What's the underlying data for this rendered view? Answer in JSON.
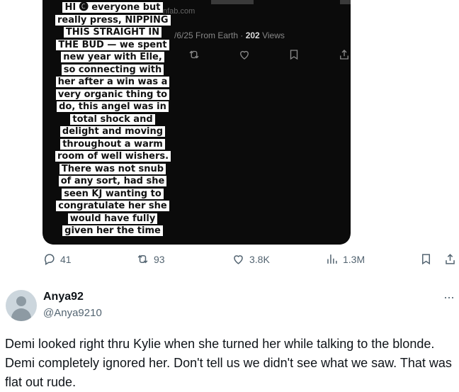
{
  "media": {
    "caption": "HI 🅒 everyone but really press, NIPPING THIS STRAIGHT IN THE BUD — we spent new year with Elle, so connecting with her after a win was a very organic thing to do, this angel was in total shock and delight and moving throughout a warm room of well wishers. There was not snub of any sort, had she seen KJ wanting to congratulate her she would have fully given her the time and space. Literally just",
    "bg_url": "nfab.com",
    "bg_meta_date": "/6/25 From Earth · ",
    "bg_meta_views_count": "202",
    "bg_meta_views_label": " Views"
  },
  "actions": {
    "replies": "41",
    "reposts": "93",
    "likes": "3.8K",
    "views": "1.3M"
  },
  "reply": {
    "name": "Anya92",
    "handle": "@Anya9210",
    "more": "···",
    "text": "Demi looked right thru Kylie when she turned her while talking to the blonde.  Demi completely ignored her. Don't tell us we didn't see what we saw. That was flat out rude."
  },
  "colors": {
    "text": "#0f1419",
    "secondary": "#536471",
    "media_bg": "#0b0b0b"
  },
  "icons": [
    "reply-icon",
    "repost-icon",
    "like-icon",
    "views-icon",
    "bookmark-icon",
    "share-icon",
    "more-icon"
  ]
}
